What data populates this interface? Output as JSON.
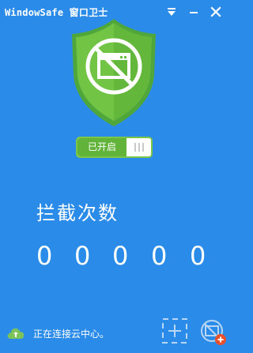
{
  "window": {
    "title": "WindowSafe 窗口卫士"
  },
  "protection": {
    "toggle_label": "已开启",
    "enabled": true
  },
  "intercept": {
    "title": "拦截次数",
    "digits": [
      "0",
      "0",
      "0",
      "0",
      "0"
    ]
  },
  "footer": {
    "status_text": "正在连接云中心。"
  },
  "colors": {
    "background": "#2a8be8",
    "shield_green": "#68bf3f",
    "toggle_green": "#62b33a",
    "badge_red": "#e8502e"
  },
  "icons": {
    "titlebar": [
      "menu-icon",
      "minimize-icon",
      "close-icon"
    ],
    "shield": "shield-icon",
    "blocked_window": "blocked-window-icon",
    "status": "cloud-upload-icon",
    "footer_left": "add-window-icon",
    "footer_right": "blocked-window-settings-icon"
  }
}
